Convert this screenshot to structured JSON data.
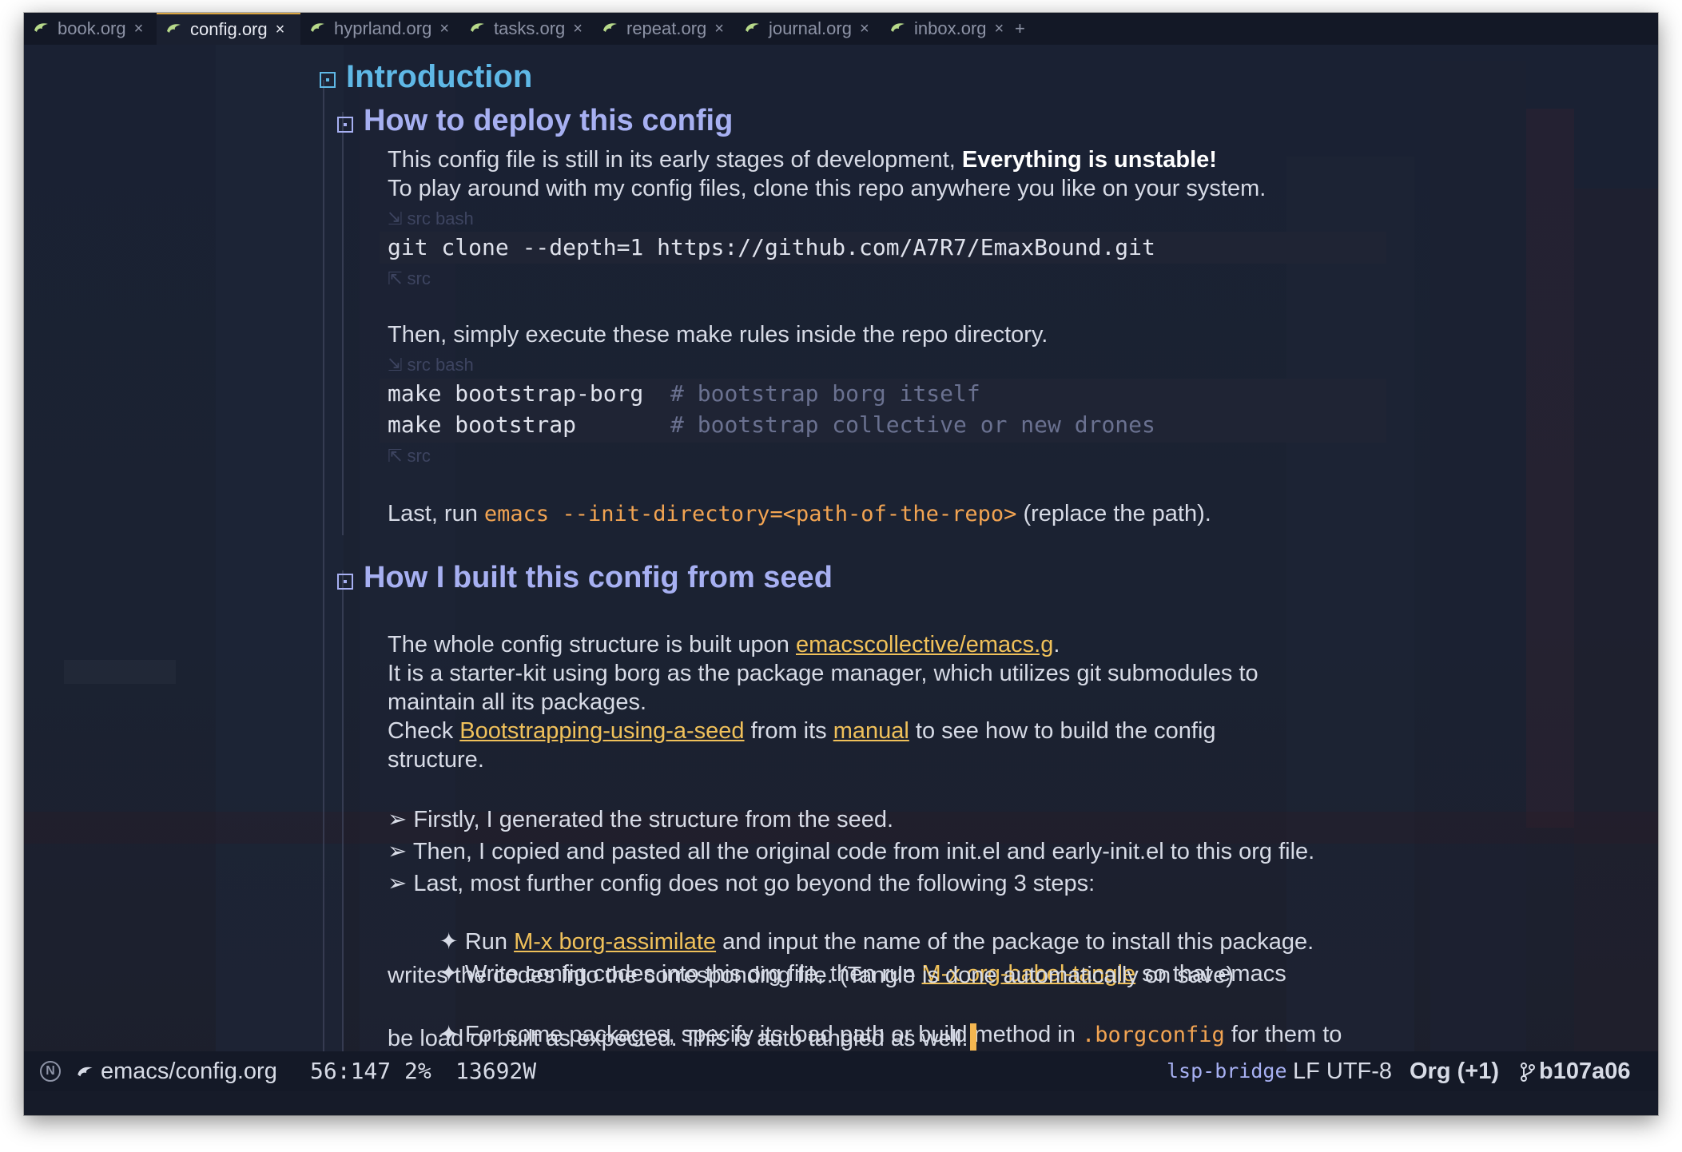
{
  "tabs": [
    {
      "label": "book.org",
      "active": false
    },
    {
      "label": "config.org",
      "active": true
    },
    {
      "label": "hyprland.org",
      "active": false
    },
    {
      "label": "tasks.org",
      "active": false
    },
    {
      "label": "repeat.org",
      "active": false
    },
    {
      "label": "journal.org",
      "active": false
    },
    {
      "label": "inbox.org",
      "active": false
    }
  ],
  "tab_close": "×",
  "tab_add": "+",
  "heading1": "Introduction",
  "section1": {
    "title": "How to deploy this config",
    "line1_a": "This config file is still in its early stages of development, ",
    "line1_b": "Everything is unstable!",
    "line2": "To play around with my config files, clone this repo anywhere you like on your system.",
    "src_begin": "⇲ src bash",
    "src_end": "⇱ src",
    "code1": "git clone --depth=1 https://github.com/A7R7/EmaxBound.git",
    "line3": "Then, simply execute these make rules inside the repo directory.",
    "code2a": "make bootstrap-borg  ",
    "code2a_comment": "# bootstrap borg itself",
    "code2b": "make bootstrap       ",
    "code2b_comment": "# bootstrap collective or new drones",
    "line4_a": "Last, run ",
    "line4_code": "emacs --init-directory=<path-of-the-repo>",
    "line4_b": " (replace the path)."
  },
  "section2": {
    "title": "How I built this config from seed",
    "p1_a": "The whole config structure is built upon ",
    "p1_link": "emacscollective/emacs.g",
    "p1_b": ".",
    "p2": "It is a starter-kit using borg as the package manager, which utilizes git submodules to",
    "p3": "maintain all its packages.",
    "p4_a": "Check ",
    "p4_link1": "Bootstrapping-using-a-seed",
    "p4_b": " from its ",
    "p4_link2": "manual",
    "p4_c": " to see how to build the config",
    "p5": "structure.",
    "b1": "➢ Firstly, I generated the structure from the seed.",
    "b2": "➢ Then, I copied and pasted all the original code from init.el and early-init.el to this org file.",
    "b3": "➢ Last, most further config does not go beyond the following 3 steps:",
    "s1_a": "  ✦ Run ",
    "s1_link": "M-x borg-assimilate",
    "s1_b": " and input the name of the package to install this package.",
    "s2_a": "  ✦ Write config codes into this org file, then run ",
    "s2_link": "M-x org-babel-tangle",
    "s2_b": " so that emacs",
    "s2_c": "writes the codes into the corresponding file. (Tangle is done automatically on save)",
    "s3_a": "  ✦ For some packages, specify its load path or build method in ",
    "s3_code": ".borgconfig",
    "s3_b": " for them to",
    "s3_c": "be load or built as expected. This is auto tangled as well."
  },
  "modeline": {
    "badge": "N",
    "file": "emacs/config.org",
    "position": "56:147",
    "percent": "2%",
    "words": "13692W",
    "lsp": "lsp-bridge",
    "encoding": "LF UTF-8",
    "mode": "Org (+1)",
    "branch": "b107a06"
  },
  "colors": {
    "background": "#161b29",
    "heading1": "#5fb8e6",
    "heading2": "#a7b0f2",
    "link": "#f0c15a",
    "code": "#f2a452",
    "cursor": "#f4b650"
  }
}
